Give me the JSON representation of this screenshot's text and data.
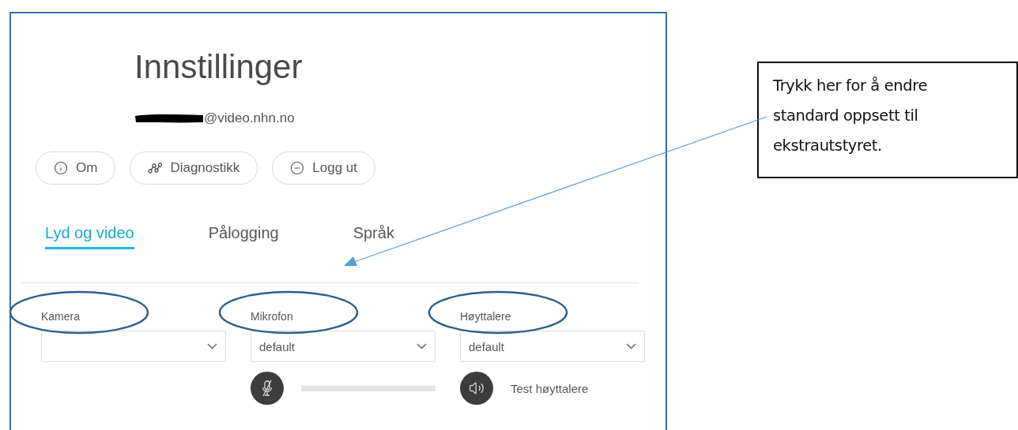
{
  "settings": {
    "title": "Innstillinger",
    "account": {
      "redacted": true,
      "email": "@video.nhn.no"
    },
    "buttons": [
      {
        "kind": "info",
        "label": "Om"
      },
      {
        "kind": "diagnostics",
        "label": "Diagnostikk"
      },
      {
        "kind": "logout",
        "label": "Logg ut"
      }
    ],
    "tabs": [
      {
        "label": "Lyd og video",
        "selected": true
      },
      {
        "label": "Pålogging",
        "selected": false
      },
      {
        "label": "Språk",
        "selected": false
      }
    ],
    "devices": [
      {
        "label": "Kamera",
        "highlighted": true
      },
      {
        "label": "Mikrofon",
        "value": "default",
        "highlighted": true
      },
      {
        "label": "Høyttalere",
        "value": "default",
        "highlighted": true
      }
    ],
    "microphone": {
      "muted": true
    },
    "speaker_test": {
      "label": "Test høyttalere"
    }
  },
  "callout": {
    "text": "Trykk her for å endre standard oppsett til ekstrautstyret."
  }
}
